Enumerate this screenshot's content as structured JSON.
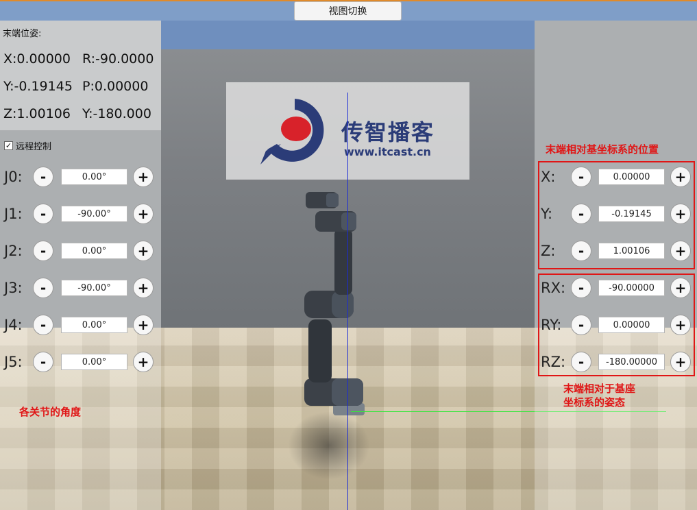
{
  "toolbar": {
    "view_switch_label": "视图切换"
  },
  "logo": {
    "text_cn": "传智播客",
    "url": "www.itcast.cn"
  },
  "pose": {
    "title": "末端位姿:",
    "x": "X:0.00000",
    "r": "R:-90.0000",
    "y": "Y:-0.19145",
    "p": "P:0.00000",
    "z": "Z:1.00106",
    "yaw": "Y:-180.000"
  },
  "remote": {
    "label": "远程控制",
    "checked": true,
    "check_glyph": "✓"
  },
  "joints": [
    {
      "label": "J0:",
      "value": "0.00°"
    },
    {
      "label": "J1:",
      "value": "-90.00°"
    },
    {
      "label": "J2:",
      "value": "0.00°"
    },
    {
      "label": "J3:",
      "value": "-90.00°"
    },
    {
      "label": "J4:",
      "value": "0.00°"
    },
    {
      "label": "J5:",
      "value": "0.00°"
    }
  ],
  "joint_note": "各关节的角度",
  "position_note": "末端相对基坐标系的位置",
  "orientation_note_line1": "末端相对于基座",
  "orientation_note_line2": "坐标系的姿态",
  "position": [
    {
      "label": "X:",
      "value": "0.00000"
    },
    {
      "label": "Y:",
      "value": "-0.19145"
    },
    {
      "label": "Z:",
      "value": "1.00106"
    }
  ],
  "orientation": [
    {
      "label": "RX:",
      "value": "-90.00000"
    },
    {
      "label": "RY:",
      "value": "0.00000"
    },
    {
      "label": "RZ:",
      "value": "-180.00000"
    }
  ],
  "buttons": {
    "minus": "-",
    "plus": "+"
  },
  "colors": {
    "annotation_red": "#e01616",
    "axis_blue": "#1b2bd6",
    "axis_green": "#37e63b",
    "accent_orange": "#e08a2a"
  }
}
